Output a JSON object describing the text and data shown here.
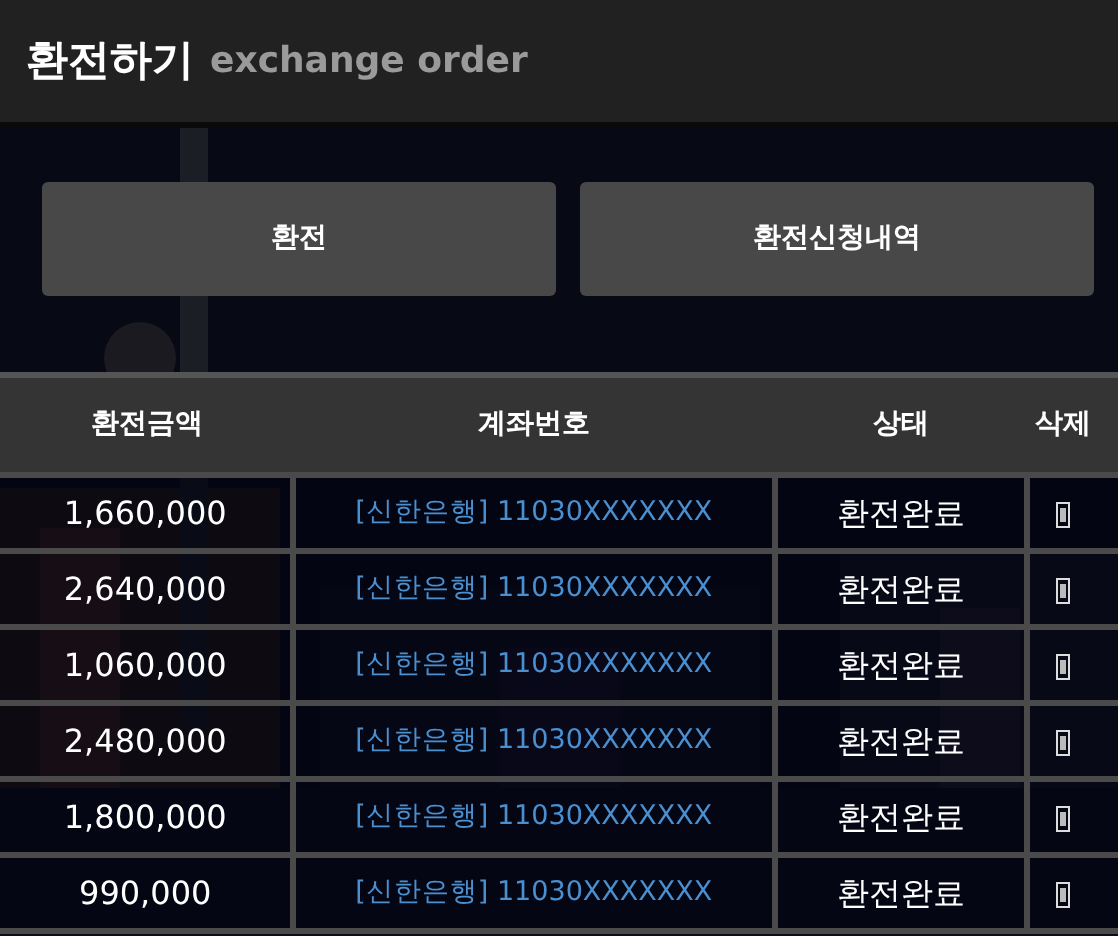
{
  "header": {
    "title": "환전하기",
    "subtitle": "exchange order"
  },
  "buttons": [
    {
      "label": "환전"
    },
    {
      "label": "환전신청내역"
    }
  ],
  "table": {
    "columns": [
      "환전금액",
      "계좌번호",
      "상태",
      "삭제"
    ],
    "rows": [
      {
        "amount": "1,660,000",
        "account": "[신한은행] 11030XXXXXXX",
        "status": "환전완료"
      },
      {
        "amount": "2,640,000",
        "account": "[신한은행] 11030XXXXXXX",
        "status": "환전완료"
      },
      {
        "amount": "1,060,000",
        "account": "[신한은행] 11030XXXXXXX",
        "status": "환전완료"
      },
      {
        "amount": "2,480,000",
        "account": "[신한은행] 11030XXXXXXX",
        "status": "환전완료"
      },
      {
        "amount": "1,800,000",
        "account": "[신한은행] 11030XXXXXXX",
        "status": "환전완료"
      },
      {
        "amount": "990,000",
        "account": "[신한은행] 11030XXXXXXX",
        "status": "환전완료"
      }
    ]
  }
}
